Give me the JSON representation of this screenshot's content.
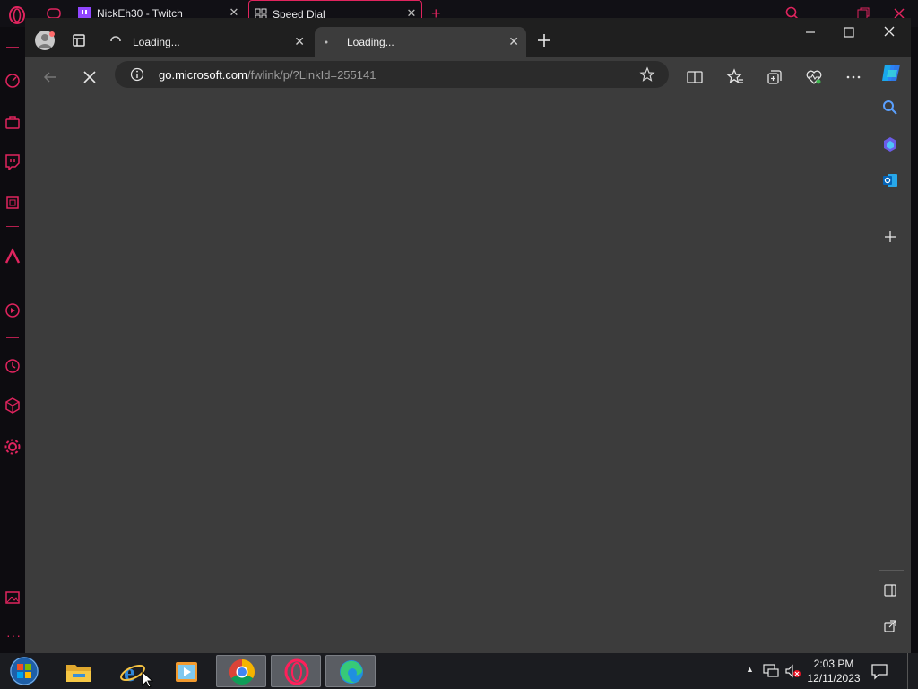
{
  "opera": {
    "tabs": [
      {
        "label": "NickEh30 - Twitch"
      },
      {
        "label": "Speed Dial"
      }
    ]
  },
  "edge": {
    "tabs": [
      {
        "label": "Loading..."
      },
      {
        "label": "Loading..."
      }
    ],
    "address": {
      "host": "go.microsoft.com",
      "path": "/fwlink/p/?LinkId=255141"
    }
  },
  "taskbar": {
    "time": "2:03 PM",
    "date": "12/11/2023"
  },
  "colors": {
    "opera_accent": "#e0245e",
    "edge_bg": "#3c3c3c",
    "taskbar_bg": "#1b1c20"
  }
}
